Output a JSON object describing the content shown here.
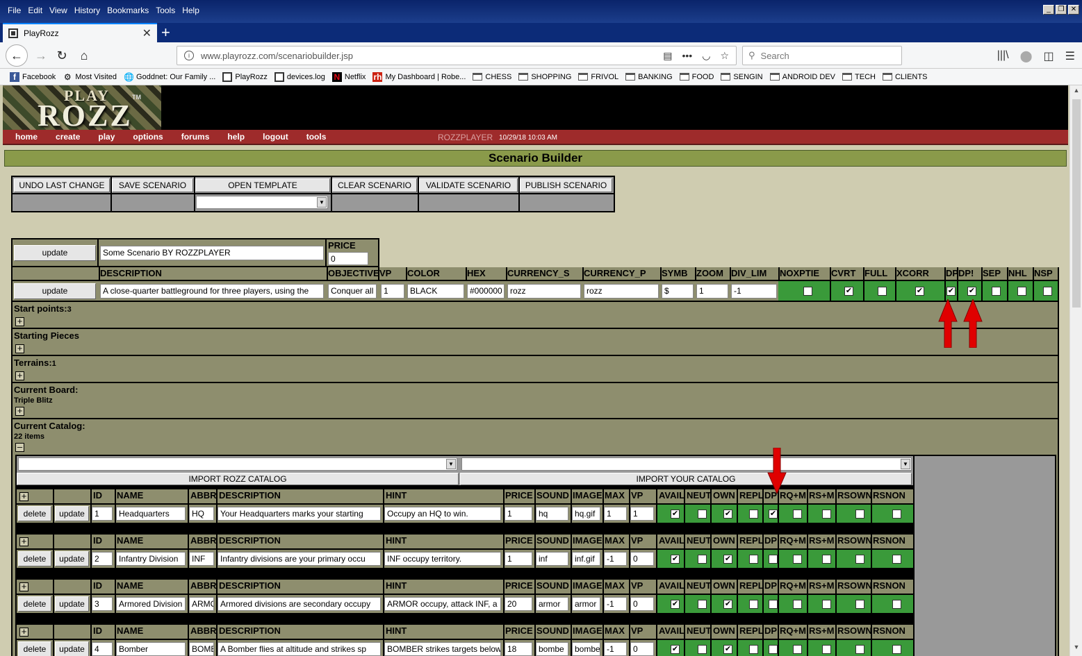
{
  "browser": {
    "menus": [
      "File",
      "Edit",
      "View",
      "History",
      "Bookmarks",
      "Tools",
      "Help"
    ],
    "tab_title": "PlayRozz",
    "url_display": "www.playrozz.com/scenariobuilder.jsp",
    "search_placeholder": "Search",
    "bookmarks": [
      {
        "label": "Facebook",
        "icon": "facebook-icon"
      },
      {
        "label": "Most Visited",
        "icon": "gear-icon"
      },
      {
        "label": "Goddnet: Our Family ...",
        "icon": "globe-icon"
      },
      {
        "label": "PlayRozz",
        "icon": "playrozz-icon"
      },
      {
        "label": "devices.log",
        "icon": "playrozz-icon"
      },
      {
        "label": "Netflix",
        "icon": "netflix-icon"
      },
      {
        "label": "My Dashboard | Robe...",
        "icon": "rh-icon"
      },
      {
        "label": "CHESS",
        "icon": "folder-icon"
      },
      {
        "label": "SHOPPING",
        "icon": "folder-icon"
      },
      {
        "label": "FRIVOL",
        "icon": "folder-icon"
      },
      {
        "label": "BANKING",
        "icon": "folder-icon"
      },
      {
        "label": "FOOD",
        "icon": "folder-icon"
      },
      {
        "label": "SENGIN",
        "icon": "folder-icon"
      },
      {
        "label": "ANDROID DEV",
        "icon": "folder-icon"
      },
      {
        "label": "TECH",
        "icon": "folder-icon"
      },
      {
        "label": "CLIENTS",
        "icon": "folder-icon"
      }
    ]
  },
  "site": {
    "logo_play": "PLAY",
    "logo_rozz": "ROZZ",
    "logo_tm": "TM",
    "nav": [
      "home",
      "create",
      "play",
      "options",
      "forums",
      "help",
      "logout",
      "tools"
    ],
    "user": "ROZZPLAYER",
    "datetime": "10/29/18 10:03 AM",
    "page_title": "Scenario Builder"
  },
  "toolbar": {
    "undo": "UNDO LAST CHANGE",
    "save": "SAVE SCENARIO",
    "open_template": "OPEN TEMPLATE",
    "clear": "CLEAR SCENARIO",
    "validate": "VALIDATE SCENARIO",
    "publish": "PUBLISH SCENARIO"
  },
  "scenario": {
    "update_label": "update",
    "name": "Some Scenario BY ROZZPLAYER",
    "price_header": "PRICE",
    "price": "0",
    "headers": [
      "DESCRIPTION",
      "OBJECTIVE",
      "VP",
      "COLOR",
      "HEX",
      "CURRENCY_S",
      "CURRENCY_P",
      "SYMB",
      "ZOOM",
      "DIV_LIM",
      "NOXPTIE",
      "CVRT",
      "FULL",
      "XCORR",
      "DP",
      "DP!",
      "SEP",
      "NHL",
      "NSP"
    ],
    "values": {
      "description": "A close-quarter battleground for three players, using the",
      "objective": "Conquer all",
      "vp": "1",
      "color": "BLACK",
      "hex": "#000000",
      "currency_s": "rozz",
      "currency_p": "rozz",
      "symb": "$",
      "zoom": "1",
      "div_lim": "-1"
    },
    "flags": [
      false,
      true,
      false,
      true,
      true,
      true,
      false,
      false,
      false
    ],
    "check_mark": "✔",
    "expand_plus": "+",
    "expand_minus": "–"
  },
  "sections": {
    "start_points": "Start points:",
    "start_points_count": "3",
    "starting_pieces": "Starting Pieces",
    "terrains": "Terrains:",
    "terrains_count": "1",
    "current_board": "Current Board:",
    "board_name": "Triple Blitz",
    "current_catalog": "Current Catalog:",
    "catalog_count": "22 items"
  },
  "catalog": {
    "import_rozz": "IMPORT ROZZ CATALOG",
    "import_yours": "IMPORT YOUR CATALOG",
    "headers": [
      "ID",
      "NAME",
      "ABBR",
      "DESCRIPTION",
      "HINT",
      "PRICE",
      "SOUND",
      "IMAGE",
      "MAX",
      "VP",
      "AVAIL",
      "NEUT",
      "OWN",
      "REPL",
      "DP",
      "RQ+M",
      "RS+M",
      "RSOWN",
      "RSNON"
    ],
    "delete_label": "delete",
    "update_label": "update",
    "rows": [
      {
        "id": "1",
        "name": "Headquarters",
        "abbr": "HQ",
        "description": "Your Headquarters marks your starting",
        "hint": "Occupy an HQ to win.",
        "price": "1",
        "sound": "hq",
        "image": "hq.gif",
        "max": "1",
        "vp": "1",
        "flags": [
          true,
          false,
          true,
          false,
          true,
          false,
          false,
          false,
          false
        ]
      },
      {
        "id": "2",
        "name": "Infantry Division",
        "abbr": "INF",
        "description": "Infantry divisions are your primary occu",
        "hint": "INF occupy territory.",
        "price": "1",
        "sound": "inf",
        "image": "inf.gif",
        "max": "-1",
        "vp": "0",
        "flags": [
          true,
          false,
          true,
          false,
          false,
          false,
          false,
          false,
          false
        ]
      },
      {
        "id": "3",
        "name": "Armored Division",
        "abbr": "ARMO",
        "description": "Armored divisions are secondary occupy",
        "hint": "ARMOR occupy, attack INF, a",
        "price": "20",
        "sound": "armor",
        "image": "armor",
        "max": "-1",
        "vp": "0",
        "flags": [
          true,
          false,
          true,
          false,
          false,
          false,
          false,
          false,
          false
        ]
      },
      {
        "id": "4",
        "name": "Bomber",
        "abbr": "BOMB",
        "description": "A Bomber flies at altitude and strikes sp",
        "hint": "BOMBER strikes targets below",
        "price": "18",
        "sound": "bombe",
        "image": "bombe",
        "max": "-1",
        "vp": "0",
        "flags": [
          true,
          false,
          true,
          false,
          false,
          false,
          false,
          false,
          false
        ]
      }
    ]
  },
  "colors": {
    "nav_red": "#9e2b2b",
    "olive": "#8e8e6e",
    "green": "#3a9a3a",
    "page_bg": "#cfccb0",
    "annotation_arrow": "#e00000"
  }
}
